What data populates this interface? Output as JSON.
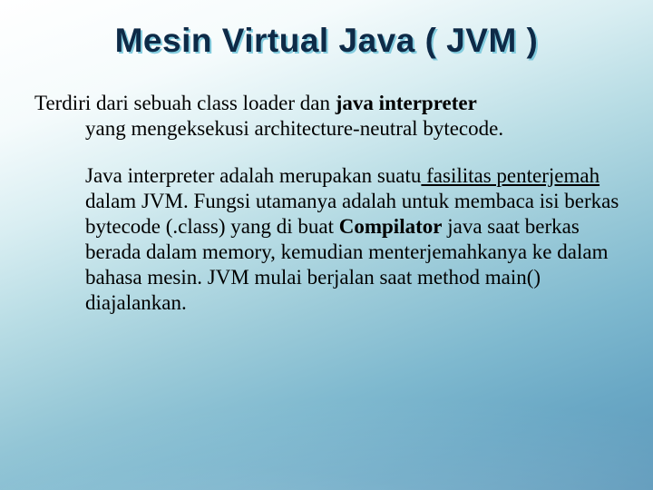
{
  "slide": {
    "title": "Mesin Virtual Java ( JVM )",
    "para1_lead": "Terdiri dari sebuah class loader dan ",
    "para1_bold": "java interpreter",
    "para1_indent": "yang mengeksekusi architecture-neutral bytecode.",
    "para2_a": "Java interpreter adalah merupakan suatu",
    "para2_ul": " fasilitas penterjemah",
    "para2_b": " dalam JVM. Fungsi utamanya adalah untuk membaca isi berkas bytecode (.class) yang di buat ",
    "para2_bold": "Compilator",
    "para2_c": " java saat berkas berada dalam memory, kemudian menterjemahkanya ke dalam bahasa mesin. JVM mulai berjalan saat method main() diajalankan."
  }
}
